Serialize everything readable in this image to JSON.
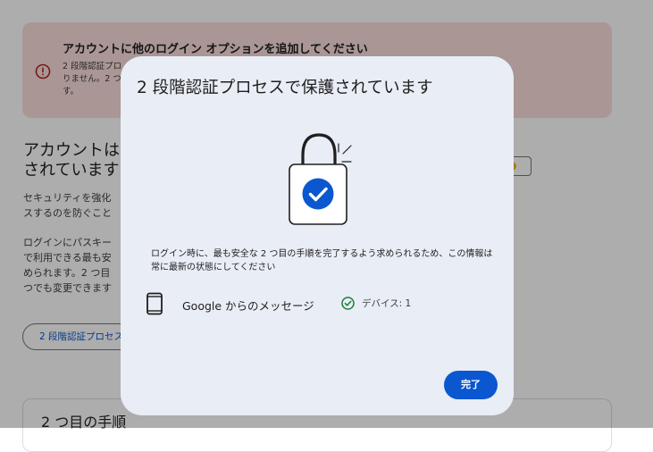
{
  "background": {
    "banner": {
      "title": "アカウントに他のログイン オプションを追加してください",
      "body": "2 段階認証プロ りません。2 つ す。"
    },
    "heading": "アカウントは されています",
    "para1": [
      "セキュリティを強化",
      "スするのを防ぐこと"
    ],
    "para2": [
      "ログインにパスキー",
      "で利用できる最も安",
      "められます。2 つ目",
      "つでも変更できます"
    ],
    "button_label": "2 段階認証プロセス",
    "card_title": "2 つ目の手順"
  },
  "dialog": {
    "title": "2 段階認証プロセスで保護されています",
    "description": "ログイン時に、最も安全な 2 つ目の手順を完了するよう求められるため、この情報は常に最新の状態にしてください",
    "method": {
      "label": "Google からのメッセージ",
      "devices": "デバイス: 1"
    },
    "done_label": "完了"
  },
  "colors": {
    "primary": "#0b57d0",
    "success": "#188038",
    "error": "#b3261e",
    "banner_bg": "#f9dedc",
    "dialog_bg": "#e9edf5"
  },
  "icons": {
    "banner": "info-icon",
    "illustration": "lock-check-illustration",
    "method": "phone-icon",
    "status": "check-circle-icon"
  }
}
